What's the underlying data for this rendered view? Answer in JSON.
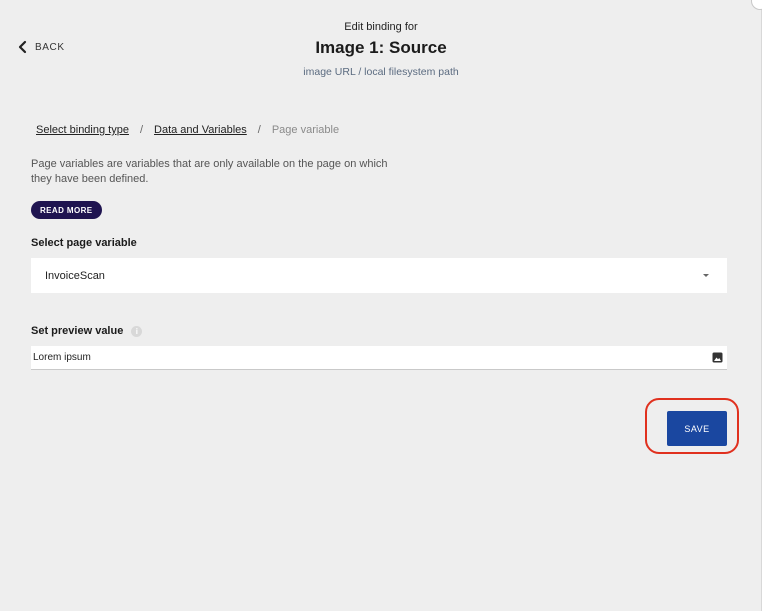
{
  "nav": {
    "back_label": "BACK"
  },
  "header": {
    "eyebrow": "Edit binding for",
    "title": "Image 1: Source",
    "subtitle": "image URL / local filesystem path"
  },
  "breadcrumb": {
    "items": [
      "Select binding type",
      "Data and Variables",
      "Page variable"
    ],
    "separator": "/"
  },
  "description": "Page variables are variables that are only available on the page on which they have been defined.",
  "read_more_label": "READ MORE",
  "page_variable": {
    "label": "Select page variable",
    "value": "InvoiceScan"
  },
  "preview": {
    "label": "Set preview value",
    "info_glyph": "i",
    "value": "Lorem ipsum"
  },
  "save_label": "SAVE",
  "colors": {
    "background": "#eeeeee",
    "save_button": "#1a47a0",
    "read_more": "#1f1450",
    "highlight": "#e0301e"
  }
}
